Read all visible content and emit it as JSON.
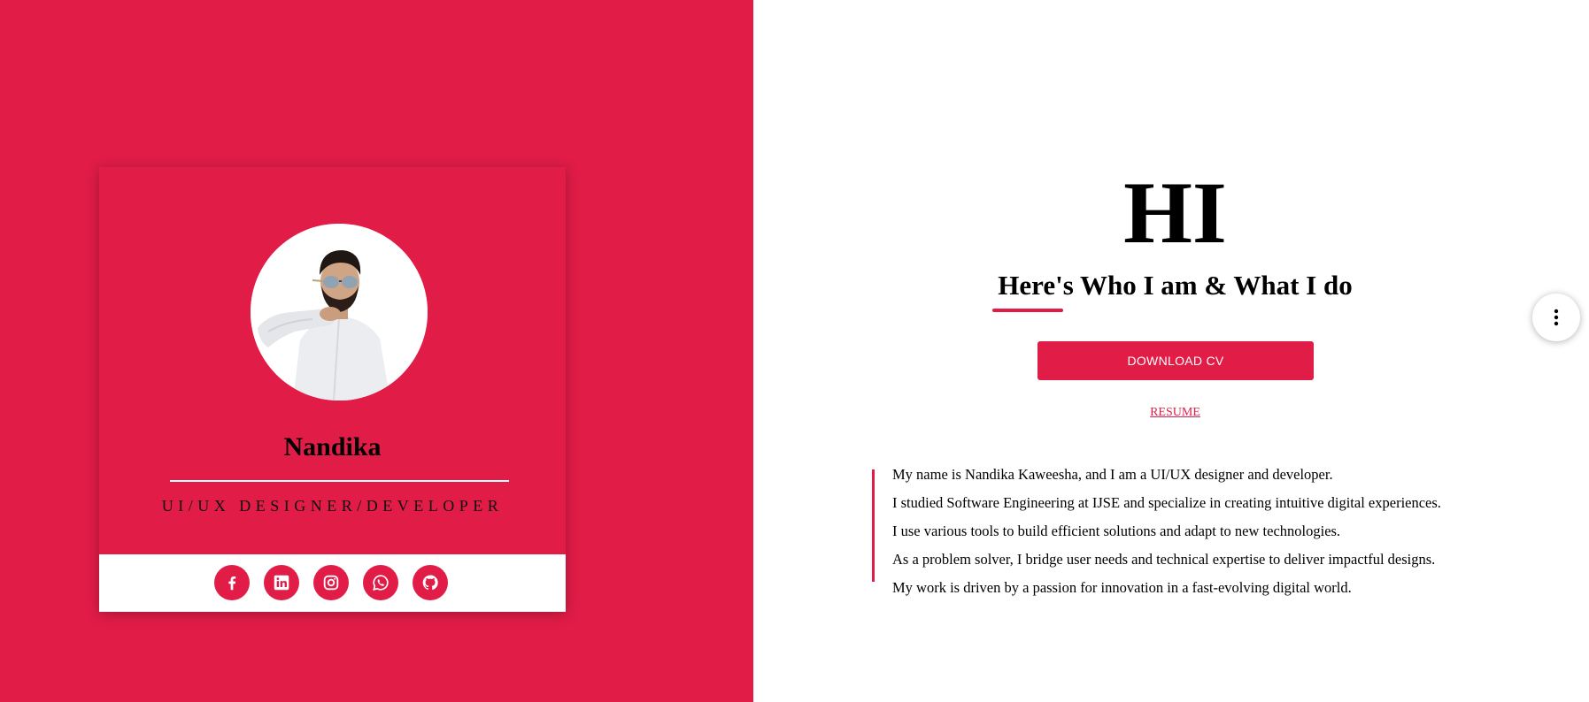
{
  "profile": {
    "name": "Nandika",
    "role": "UI/UX DESIGNER/DEVELOPER"
  },
  "social": [
    {
      "icon": "facebook-icon"
    },
    {
      "icon": "linkedin-icon"
    },
    {
      "icon": "instagram-icon"
    },
    {
      "icon": "whatsapp-icon"
    },
    {
      "icon": "github-icon"
    }
  ],
  "intro": {
    "greeting": "HI",
    "subtitle": "Here's Who I am & What I do",
    "download_label": "DOWNLOAD CV",
    "resume_label": "RESUME"
  },
  "about": {
    "lines": [
      "My name is Nandika Kaweesha, and I am a UI/UX designer and developer.",
      "I studied Software Engineering at IJSE and specialize in creating intuitive digital experiences.",
      "I use various tools to build efficient solutions and adapt to new technologies.",
      "As a problem solver, I bridge user needs and technical expertise to deliver impactful designs.",
      "My work is driven by a passion for innovation in a fast-evolving digital world."
    ]
  },
  "menu": {
    "icon": "more-vertical-icon"
  },
  "colors": {
    "accent": "#e11c47",
    "background": "#ffffff",
    "text": "#000000"
  }
}
